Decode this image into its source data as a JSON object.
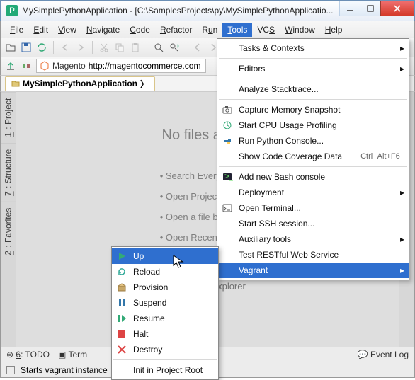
{
  "window": {
    "title": "MySimplePythonApplication - [C:\\SamplesProjects\\py\\MySimplePythonApplicatio..."
  },
  "menubar": {
    "file": "File",
    "edit": "Edit",
    "view": "View",
    "navigate": "Navigate",
    "code": "Code",
    "refactor": "Refactor",
    "run": "Run",
    "tools": "Tools",
    "vcs": "VCS",
    "window": "Window",
    "help": "Help"
  },
  "url": {
    "label": "Magento",
    "value": "http://magentocommerce.com"
  },
  "breadcrumb": {
    "project": "MySimplePythonApplication"
  },
  "sidebar": {
    "project": "1: Project",
    "structure": "7: Structure",
    "favorites": "2: Favorites"
  },
  "editor": {
    "heading": "No files are op",
    "hints": [
      "• Search Everywhere w",
      "• Open Project View w",
      "• Open a file by name",
      "• Open Recent Files wi"
    ],
    "dragline": "here from Explorer"
  },
  "bottom": {
    "todo": "6: TODO",
    "terminal": "Term",
    "eventlog": "Event Log"
  },
  "status": {
    "text": "Starts vagrant instance"
  },
  "tools_menu": {
    "tasks": "Tasks & Contexts",
    "editors": "Editors",
    "stacktrace": "Analyze Stacktrace...",
    "memsnap": "Capture Memory Snapshot",
    "cpuprof": "Start CPU Usage Profiling",
    "pyconsole": "Run Python Console...",
    "coverage": "Show Code Coverage Data",
    "coverage_sc": "Ctrl+Alt+F6",
    "bash": "Add new Bash console",
    "deployment": "Deployment",
    "terminal": "Open Terminal...",
    "ssh": "Start SSH session...",
    "aux": "Auxiliary tools",
    "rest": "Test RESTful Web Service",
    "vagrant": "Vagrant"
  },
  "vagrant_menu": {
    "up": "Up",
    "reload": "Reload",
    "provision": "Provision",
    "suspend": "Suspend",
    "resume": "Resume",
    "halt": "Halt",
    "destroy": "Destroy",
    "init": "Init in Project Root"
  }
}
